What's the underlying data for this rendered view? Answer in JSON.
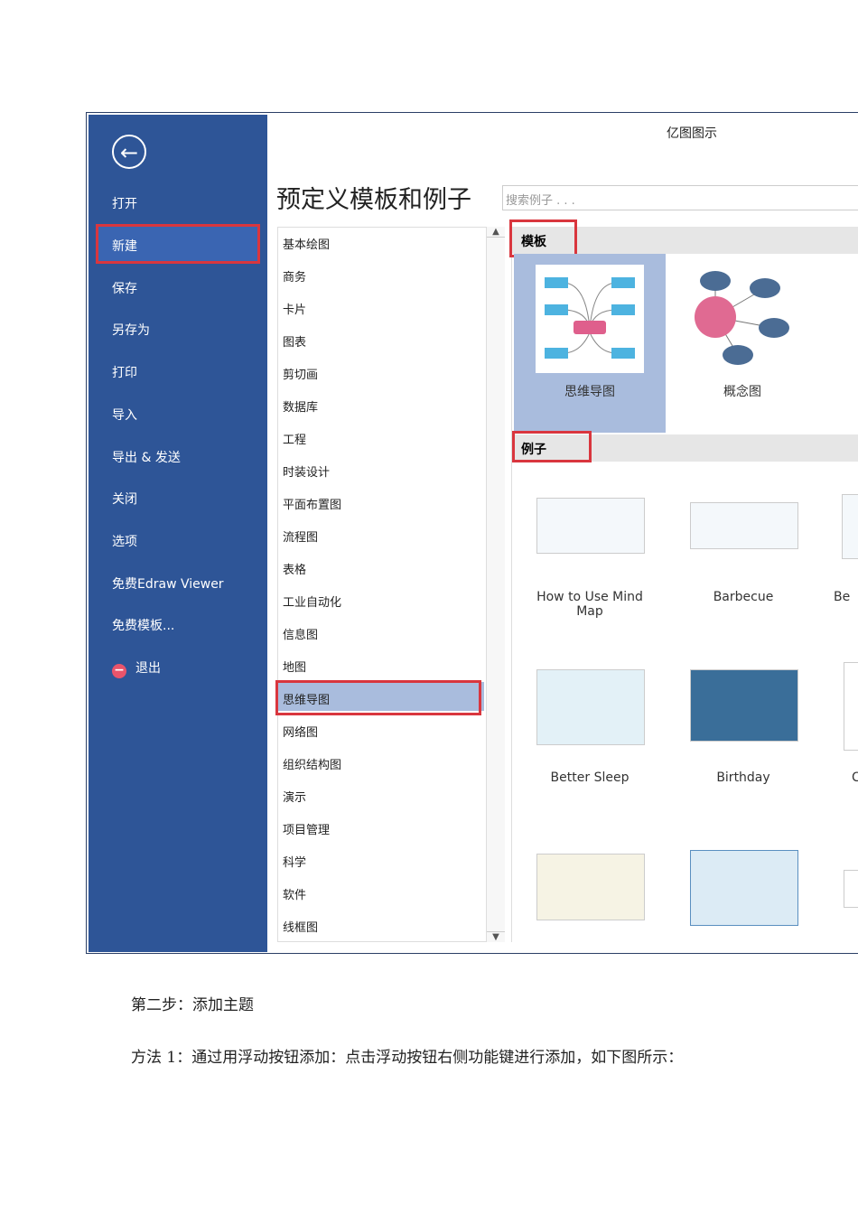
{
  "app": {
    "title": "亿图图示",
    "heading": "预定义模板和例子",
    "search_placeholder": "搜索例子 . . ."
  },
  "sidebar": {
    "items": [
      "打开",
      "新建",
      "保存",
      "另存为",
      "打印",
      "导入",
      "导出 & 发送",
      "关闭",
      "选项",
      "免费Edraw Viewer",
      "免费模板...",
      "退出"
    ]
  },
  "categories": [
    "基本绘图",
    "商务",
    "卡片",
    "图表",
    "剪切画",
    "数据库",
    "工程",
    "时装设计",
    "平面布置图",
    "流程图",
    "表格",
    "工业自动化",
    "信息图",
    "地图",
    "思维导图",
    "网络图",
    "组织结构图",
    "演示",
    "项目管理",
    "科学",
    "软件",
    "线框图"
  ],
  "templates": {
    "section": "模板",
    "items": [
      "思维导图",
      "概念图"
    ]
  },
  "examples": {
    "section": "例子",
    "items": [
      "How to Use Mind Map",
      "Barbecue",
      "Be",
      "Better Sleep",
      "Birthday",
      "C"
    ]
  },
  "doc": {
    "step": "第二步：添加主题",
    "method": "方法 1：通过用浮动按钮添加：点击浮动按钮右侧功能键进行添加，如下图所示："
  }
}
